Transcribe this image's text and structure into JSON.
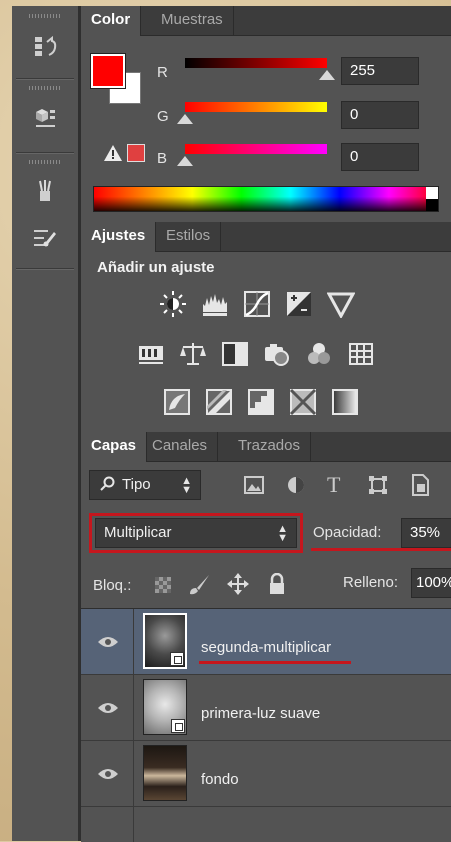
{
  "color_panel": {
    "tabs": [
      "Color",
      "Muestras"
    ],
    "r_label": "R",
    "g_label": "G",
    "b_label": "B",
    "r_value": "255",
    "g_value": "0",
    "b_value": "0",
    "foreground_color": "#ff0000",
    "background_color": "#ffffff"
  },
  "adjustments_panel": {
    "tabs": [
      "Ajustes",
      "Estilos"
    ],
    "heading": "Añadir un ajuste",
    "icons": [
      "brightness-contrast-icon",
      "levels-icon",
      "curves-icon",
      "exposure-icon",
      "vibrance-icon",
      "hue-saturation-icon",
      "color-balance-icon",
      "black-white-icon",
      "photo-filter-icon",
      "channel-mixer-icon",
      "color-lookup-icon",
      "invert-icon",
      "posterize-icon",
      "threshold-icon",
      "selective-color-icon",
      "gradient-map-icon"
    ]
  },
  "layers_panel": {
    "tabs": [
      "Capas",
      "Canales",
      "Trazados"
    ],
    "filter_label": "Tipo",
    "blend_mode": "Multiplicar",
    "opacity_label": "Opacidad:",
    "opacity_value": "35%",
    "lock_label": "Bloq.:",
    "fill_label": "Relleno:",
    "fill_value": "100%",
    "layers": [
      {
        "name": "segunda-multiplicar",
        "selected": true
      },
      {
        "name": "primera-luz suave",
        "selected": false
      },
      {
        "name": "fondo",
        "selected": false
      }
    ]
  },
  "accent_color": "#c5161d"
}
